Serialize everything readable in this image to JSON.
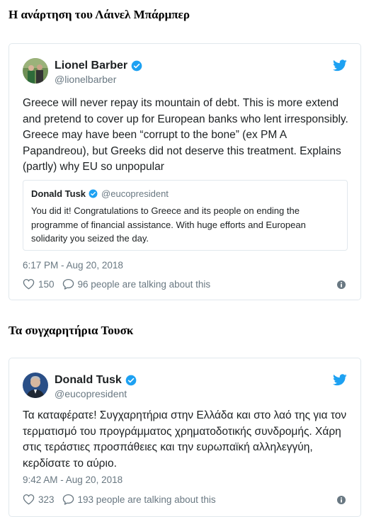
{
  "headings": {
    "first": "Η ανάρτηση του Λάινελ Μπάρμπερ",
    "second": "Τα συγχαρητήρια Τουσκ"
  },
  "tweet1": {
    "name": "Lionel Barber",
    "handle": "@lionelbarber",
    "text": "Greece will never repay its mountain of debt.  This is more extend and pretend to cover up for European banks who lent irresponsibly.  Greece may have been “corrupt to the bone” (ex PM A Papandreou), but Greeks did not deserve this treatment. Explains (partly) why EU so unpopular",
    "quote": {
      "name": "Donald Tusk",
      "handle": "@eucopresident",
      "text": "You did it! Congratulations to Greece and its people on ending the programme of financial assistance. With huge efforts and European solidarity you seized the day."
    },
    "timestamp": "6:17 PM - Aug 20, 2018",
    "likes": "150",
    "talking": "96 people are talking about this"
  },
  "tweet2": {
    "name": "Donald Tusk",
    "handle": "@eucopresident",
    "text": "Τα καταφέρατε! Συγχαρητήρια στην Ελλάδα και στο λαό της για τον τερματισμό του προγράμματος χρηματοδοτικής συνδρομής. Χάρη στις τεράστιες προσπάθειες και την ευρωπαϊκή αλληλεγγύη, κερδίσατε το αύριο.",
    "timestamp": "9:42 AM - Aug 20, 2018",
    "likes": "323",
    "talking": "193 people are talking about this"
  },
  "colors": {
    "twitter_blue": "#1da1f2",
    "muted": "#697882",
    "border": "#e1e8ed"
  },
  "icons": [
    "twitter-bird-icon",
    "verified-badge-icon",
    "heart-icon",
    "comment-bubble-icon",
    "info-icon"
  ]
}
